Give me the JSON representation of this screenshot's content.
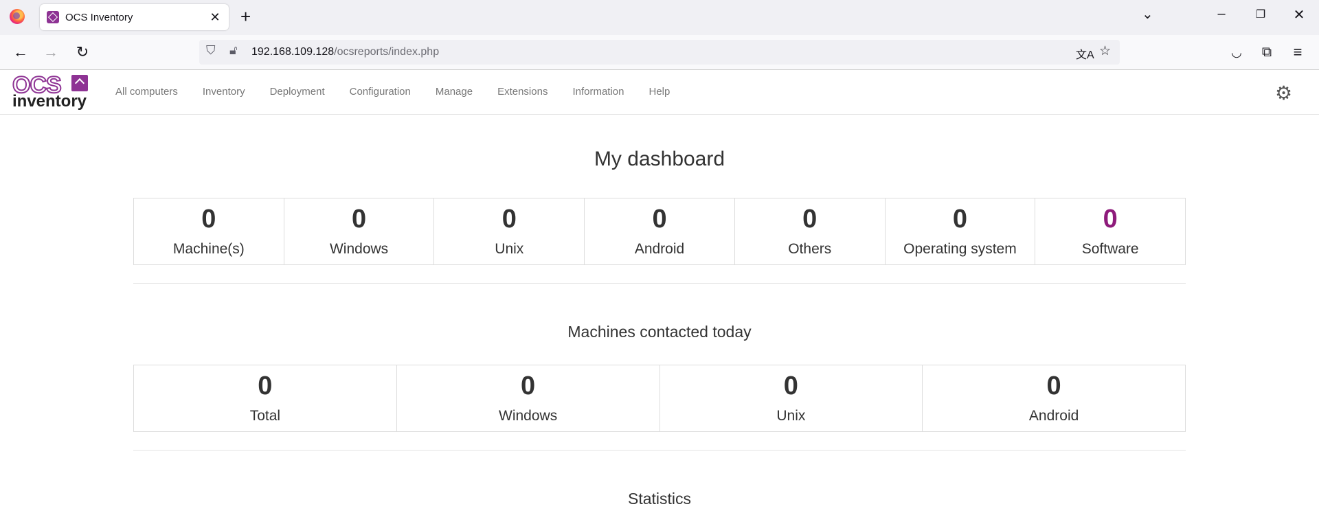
{
  "browser": {
    "tab_title": "OCS Inventory",
    "url_host": "192.168.109.128",
    "url_path": "/ocsreports/index.php"
  },
  "app": {
    "logo_top": "OCS",
    "logo_bottom": "inventory",
    "menu": [
      "All computers",
      "Inventory",
      "Deployment",
      "Configuration",
      "Manage",
      "Extensions",
      "Information",
      "Help"
    ]
  },
  "dashboard": {
    "title": "My dashboard",
    "stats": [
      {
        "value": "0",
        "label": "Machine(s)"
      },
      {
        "value": "0",
        "label": "Windows"
      },
      {
        "value": "0",
        "label": "Unix"
      },
      {
        "value": "0",
        "label": "Android"
      },
      {
        "value": "0",
        "label": "Others"
      },
      {
        "value": "0",
        "label": "Operating system"
      },
      {
        "value": "0",
        "label": "Software"
      }
    ],
    "contacted_title": "Machines contacted today",
    "contacted": [
      {
        "value": "0",
        "label": "Total"
      },
      {
        "value": "0",
        "label": "Windows"
      },
      {
        "value": "0",
        "label": "Unix"
      },
      {
        "value": "0",
        "label": "Android"
      }
    ],
    "statistics_title": "Statistics"
  },
  "colors": {
    "brand": "#8e3394",
    "highlight_number": "#8e1b7b"
  }
}
